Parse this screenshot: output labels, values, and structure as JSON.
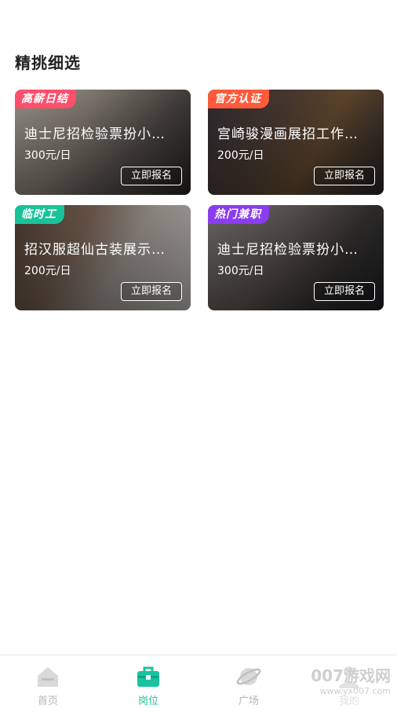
{
  "section": {
    "title": "精挑细选"
  },
  "cards": [
    {
      "tag": "高薪日结",
      "title": "迪士尼招检验票扮小…",
      "price": "300元/日",
      "button": "立即报名",
      "tag_color": "#ff4f6d"
    },
    {
      "tag": "官方认证",
      "title": "宫崎骏漫画展招工作…",
      "price": "200元/日",
      "button": "立即报名",
      "tag_color": "#ff5a3c"
    },
    {
      "tag": "临时工",
      "title": "招汉服超仙古装展示…",
      "price": "200元/日",
      "button": "立即报名",
      "tag_color": "#19c39a"
    },
    {
      "tag": "热门兼职",
      "title": "迪士尼招检验票扮小…",
      "price": "300元/日",
      "button": "立即报名",
      "tag_color": "#8a3cf0"
    }
  ],
  "nav": {
    "items": [
      {
        "label": "首页",
        "icon": "home-icon"
      },
      {
        "label": "岗位",
        "icon": "briefcase-icon",
        "active": true
      },
      {
        "label": "广场",
        "icon": "planet-icon"
      },
      {
        "label": "我的",
        "icon": "profile-icon"
      }
    ]
  },
  "watermark": {
    "logo": "007游戏网",
    "url": "www.yx007.com"
  },
  "colors": {
    "accent": "#19c3a0"
  }
}
